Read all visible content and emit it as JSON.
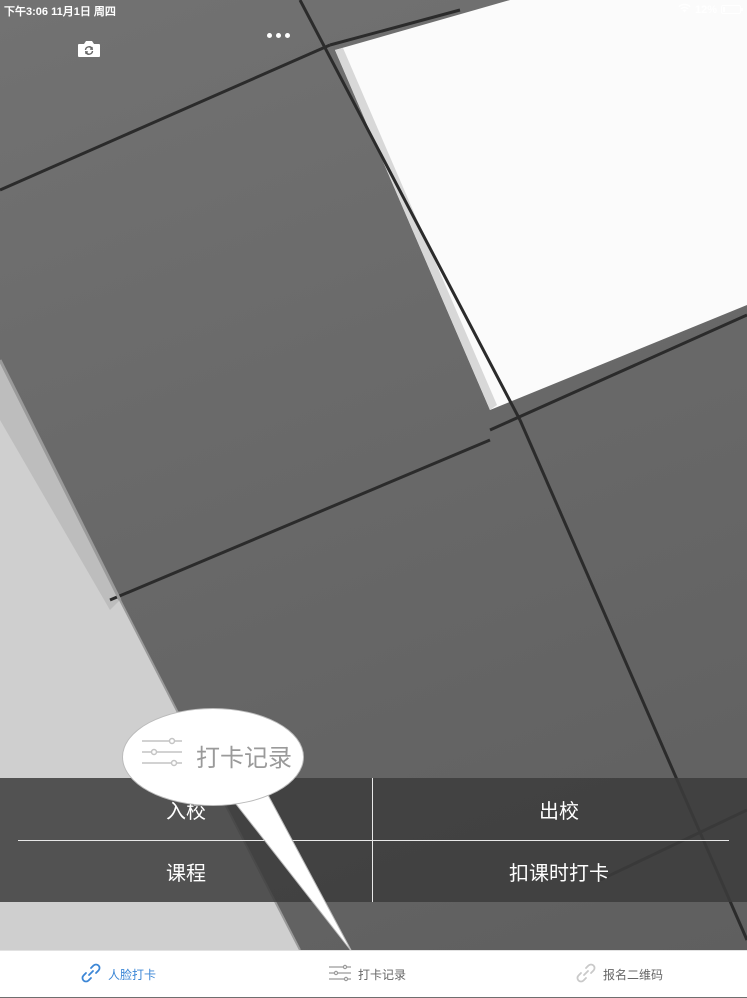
{
  "status_bar": {
    "time_date": "下午3:06  11月1日 周四",
    "battery_percent": "12%",
    "battery_level": 0.12
  },
  "top_controls": {
    "camera_switch_icon": "camera-switch-icon",
    "more_icon": "more-icon"
  },
  "actions": {
    "enter_school": "入校",
    "leave_school": "出校",
    "course": "课程",
    "class_check_in": "扣课时打卡"
  },
  "callout": {
    "label": "打卡记录",
    "icon": "sliders-icon"
  },
  "tabs": [
    {
      "label": "人脸打卡",
      "icon": "link-icon",
      "active": true
    },
    {
      "label": "打卡记录",
      "icon": "sliders-icon",
      "active": false
    },
    {
      "label": "报名二维码",
      "icon": "link-icon",
      "active": false
    }
  ],
  "colors": {
    "accent": "#3b86d6",
    "inactive_tab": "#666666"
  }
}
